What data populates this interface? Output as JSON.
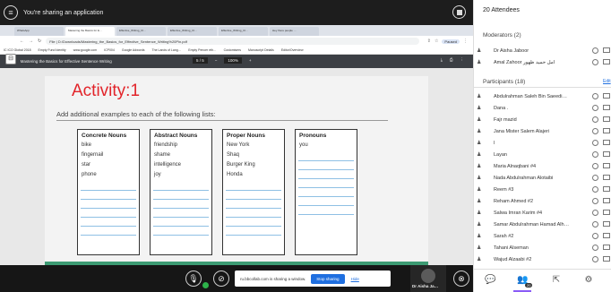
{
  "share": {
    "title": "You're sharing an application",
    "menu_icon": "hamburger-menu-icon",
    "record_icon": "stop-recording-icon"
  },
  "browser": {
    "tabs": [
      "WhatsApp",
      "Mastering the Basics for E…",
      "Effective_Writing_Cl…",
      "Effective_Writing_Cl…",
      "Effective_Writing_Cl…",
      "Hey there people …"
    ],
    "address": "File | D:/Downloads/Mastering_the_Basics_for_Effective_Sentence_Writing%20Pin.pdf",
    "profile": "Paused",
    "bookmarks": [
      "IC ICO Global 2018",
      "Empty Fund Identity",
      "www.google.com",
      "ICP004",
      "Google Adwords",
      "The Lands of Lang…",
      "Empty Pencer eth…",
      "Customisers",
      "Manuscript Details",
      "Editor/Overview"
    ],
    "pdf_title": "Mastering the Basics for Effective Sentence Writing",
    "page_indicator": "5 / 5",
    "zoom": "100%"
  },
  "worksheet": {
    "heading": "Activity:1",
    "instruction": "Add additional examples to each of the following lists:",
    "columns": [
      {
        "header": "Concrete Nouns",
        "items": [
          "bike",
          "fingernail",
          "star",
          "phone"
        ]
      },
      {
        "header": "Abstract Nouns",
        "items": [
          "friendship",
          "shame",
          "intelligence",
          "joy"
        ]
      },
      {
        "header": "Proper Nouns",
        "items": [
          "New York",
          "Shaq",
          "Burger King",
          "Honda"
        ]
      },
      {
        "header": "Pronouns",
        "items": [
          "you",
          "",
          "",
          ""
        ]
      }
    ]
  },
  "meeting": {
    "notice": "ru.bbcollab.com is sharing a window.",
    "stop_sharing": "Stop sharing",
    "hide": "Hide",
    "presenter_name": "Dr Aisha Ja…"
  },
  "panel": {
    "attendees_title": "20 Attendees",
    "moderators_title": "Moderators (2)",
    "moderators": [
      "Dr Aisha Jaboor",
      "Amal Zahoor امل حمید ظهور"
    ],
    "participants_title": "Participants (18)",
    "edit": "Edit",
    "participants": [
      "Abdulrahman Saleh Bin Saeedi…",
      "Dana .",
      "Fajr mazid",
      "Jana Mister Salem Alajeri",
      "l",
      "Layan",
      "Maria Alnaqbani #4",
      "Nada Abdulrahman Alotaibi",
      "Reem #3",
      "Reham Ahmed #2",
      "Salwa Imran Karim #4",
      "Samar Abdulrahman Hamad Alh…",
      "Sarah #2",
      "Tahani Alseman",
      "Wajud Alzaabi #2"
    ]
  }
}
